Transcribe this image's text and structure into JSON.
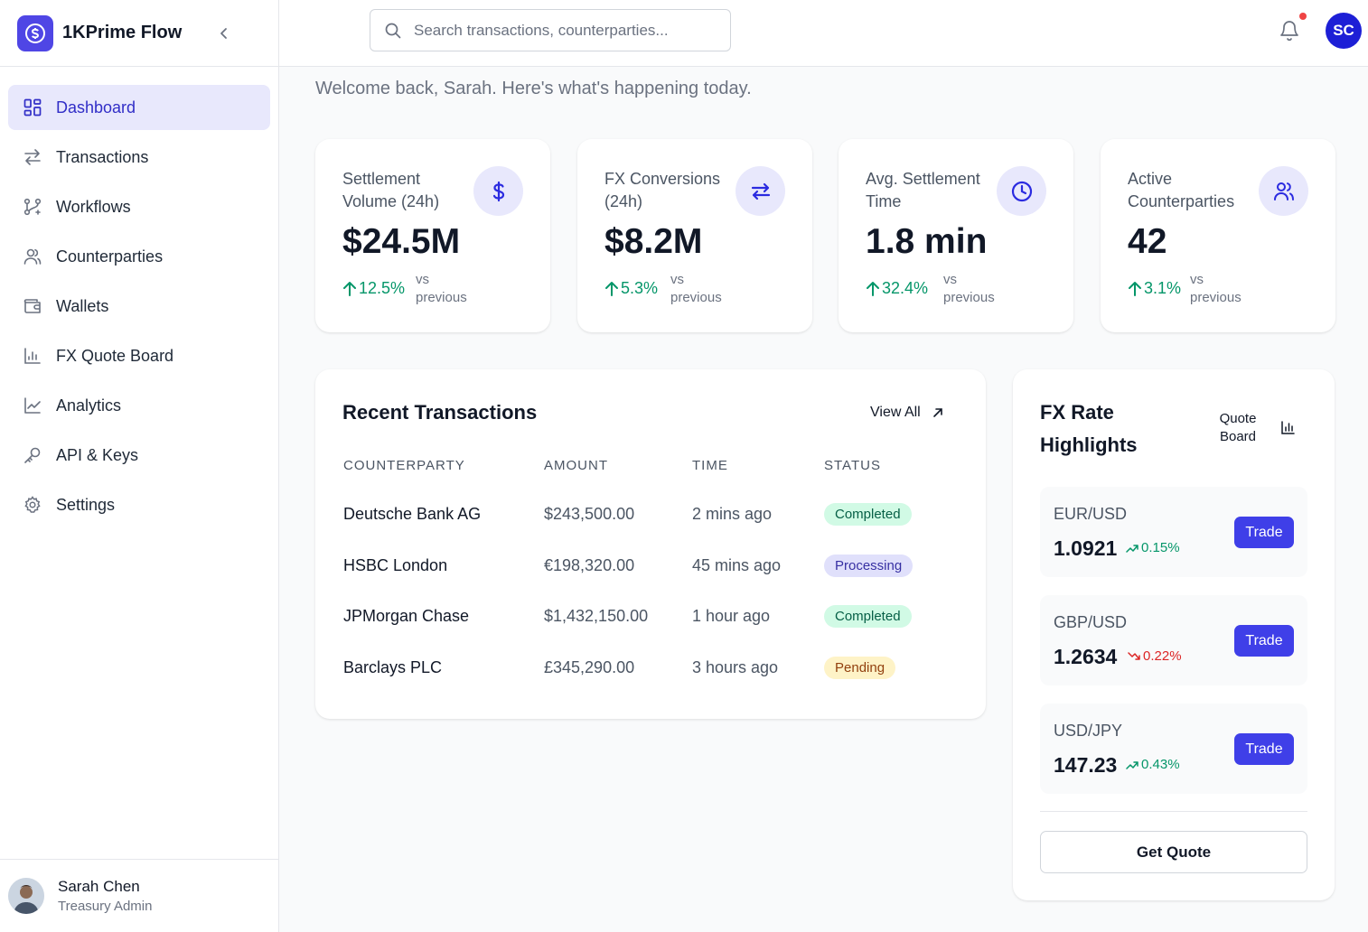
{
  "app": {
    "name": "1KPrime Flow"
  },
  "sidebar": {
    "items": [
      {
        "label": "Dashboard",
        "icon": "grid-icon",
        "active": true
      },
      {
        "label": "Transactions",
        "icon": "arrows-swap-icon"
      },
      {
        "label": "Workflows",
        "icon": "workflow-icon"
      },
      {
        "label": "Counterparties",
        "icon": "users-icon"
      },
      {
        "label": "Wallets",
        "icon": "wallet-icon"
      },
      {
        "label": "FX Quote Board",
        "icon": "bar-chart-icon"
      },
      {
        "label": "Analytics",
        "icon": "line-chart-icon"
      },
      {
        "label": "API & Keys",
        "icon": "key-icon"
      },
      {
        "label": "Settings",
        "icon": "gear-icon"
      }
    ]
  },
  "user": {
    "name": "Sarah Chen",
    "role": "Treasury Admin",
    "initials": "SC"
  },
  "header": {
    "search_placeholder": "Search transactions, counterparties...",
    "has_notification": true
  },
  "welcome": "Welcome back, Sarah. Here's what's happening today.",
  "stats": [
    {
      "label": "Settlement Volume (24h)",
      "value": "$24.5M",
      "change": "12.5%",
      "vs": "vs previous",
      "icon": "dollar-icon"
    },
    {
      "label": "FX Conversions (24h)",
      "value": "$8.2M",
      "change": "5.3%",
      "vs": "vs previous",
      "icon": "arrows-swap-icon"
    },
    {
      "label": "Avg. Settlement Time",
      "value": "1.8 min",
      "change": "32.4%",
      "vs": "vs previous",
      "icon": "clock-icon"
    },
    {
      "label": "Active Counterparties",
      "value": "42",
      "change": "3.1%",
      "vs": "vs previous",
      "icon": "users-icon"
    }
  ],
  "transactions": {
    "title": "Recent Transactions",
    "view_all": "View All",
    "columns": [
      "COUNTERPARTY",
      "AMOUNT",
      "TIME",
      "STATUS"
    ],
    "rows": [
      {
        "counterparty": "Deutsche Bank AG",
        "amount": "$243,500.00",
        "time": "2 mins ago",
        "status": "Completed"
      },
      {
        "counterparty": "HSBC London",
        "amount": "€198,320.00",
        "time": "45 mins ago",
        "status": "Processing"
      },
      {
        "counterparty": "JPMorgan Chase",
        "amount": "$1,432,150.00",
        "time": "1 hour ago",
        "status": "Completed"
      },
      {
        "counterparty": "Barclays PLC",
        "amount": "£345,290.00",
        "time": "3 hours ago",
        "status": "Pending"
      }
    ]
  },
  "fx": {
    "title": "FX Rate Highlights",
    "quote_board": "Quote Board",
    "pairs": [
      {
        "pair": "EUR/USD",
        "rate": "1.0921",
        "change": "0.15%",
        "direction": "up",
        "action": "Trade"
      },
      {
        "pair": "GBP/USD",
        "rate": "1.2634",
        "change": "0.22%",
        "direction": "down",
        "action": "Trade"
      },
      {
        "pair": "USD/JPY",
        "rate": "147.23",
        "change": "0.43%",
        "direction": "up",
        "action": "Trade"
      }
    ],
    "get_quote": "Get Quote"
  },
  "colors": {
    "accent": "#4f46e5",
    "positive": "#059669",
    "negative": "#dc2626",
    "notification": "#ef4444"
  }
}
